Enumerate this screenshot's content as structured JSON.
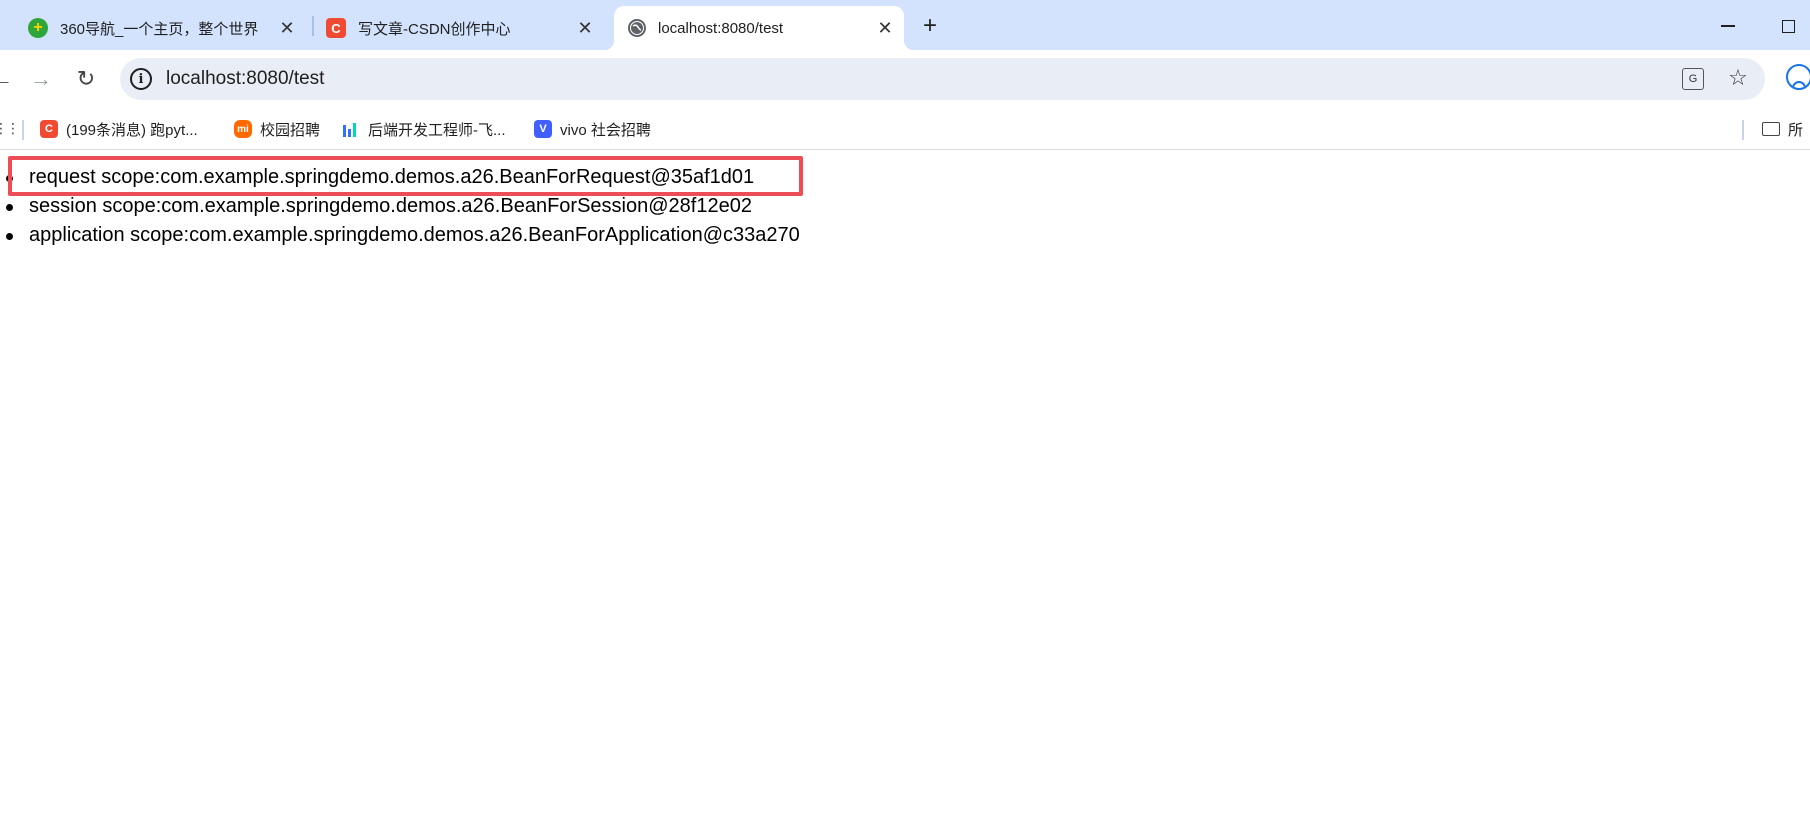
{
  "tabs": [
    {
      "title": "360导航_一个主页，整个世界",
      "favicon": "360-nav-icon",
      "favicon_color": "#2fa63a",
      "active": false
    },
    {
      "title": "写文章-CSDN创作中心",
      "favicon": "csdn-icon",
      "favicon_color": "#f04b32",
      "active": false
    },
    {
      "title": "localhost:8080/test",
      "favicon": "globe-icon",
      "favicon_color": "#5f6368",
      "active": true
    }
  ],
  "toolbar": {
    "url": "localhost:8080/test"
  },
  "bookmarks": [
    {
      "label": "(199条消息) 跑pyt...",
      "icon": "csdn-icon",
      "icon_glyph": "C",
      "color": "#f04b32"
    },
    {
      "label": "校园招聘",
      "icon": "mi-icon",
      "icon_glyph": "mi",
      "color": "#ff6a00"
    },
    {
      "label": "后端开发工程师-飞...",
      "icon": "bar-chart-icon",
      "icon_glyph": "",
      "color": "#3370ff"
    },
    {
      "label": "vivo 社会招聘",
      "icon": "vivo-icon",
      "icon_glyph": "V",
      "color": "#415fff"
    }
  ],
  "bookmarks_folder": {
    "label": "所"
  },
  "content": {
    "items": [
      "request scope:com.example.springdemo.demos.a26.BeanForRequest@35af1d01",
      "session scope:com.example.springdemo.demos.a26.BeanForSession@28f12e02",
      "application scope:com.example.springdemo.demos.a26.BeanForApplication@c33a270"
    ],
    "highlight_color": "#ee4d55"
  },
  "colors": {
    "tabstrip": "#d3e3fd",
    "omnibox": "#e9eef6"
  }
}
